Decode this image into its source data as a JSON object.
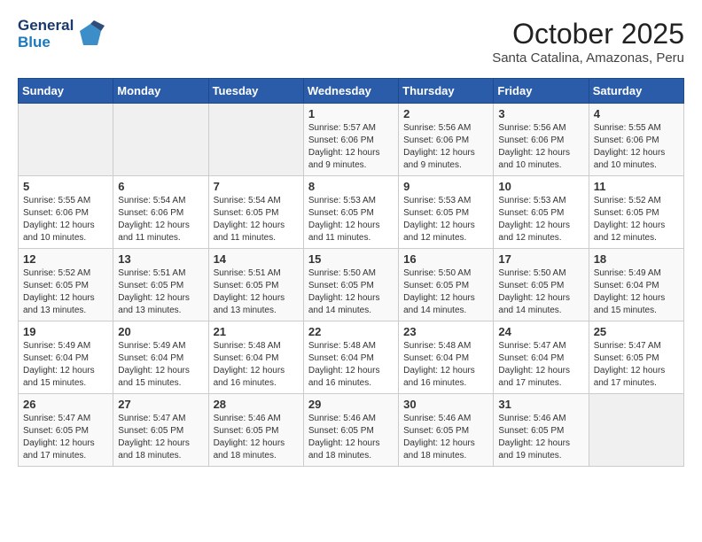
{
  "logo": {
    "line1": "General",
    "line2": "Blue"
  },
  "title": "October 2025",
  "subtitle": "Santa Catalina, Amazonas, Peru",
  "weekdays": [
    "Sunday",
    "Monday",
    "Tuesday",
    "Wednesday",
    "Thursday",
    "Friday",
    "Saturday"
  ],
  "weeks": [
    [
      {
        "day": "",
        "info": ""
      },
      {
        "day": "",
        "info": ""
      },
      {
        "day": "",
        "info": ""
      },
      {
        "day": "1",
        "info": "Sunrise: 5:57 AM\nSunset: 6:06 PM\nDaylight: 12 hours\nand 9 minutes."
      },
      {
        "day": "2",
        "info": "Sunrise: 5:56 AM\nSunset: 6:06 PM\nDaylight: 12 hours\nand 9 minutes."
      },
      {
        "day": "3",
        "info": "Sunrise: 5:56 AM\nSunset: 6:06 PM\nDaylight: 12 hours\nand 10 minutes."
      },
      {
        "day": "4",
        "info": "Sunrise: 5:55 AM\nSunset: 6:06 PM\nDaylight: 12 hours\nand 10 minutes."
      }
    ],
    [
      {
        "day": "5",
        "info": "Sunrise: 5:55 AM\nSunset: 6:06 PM\nDaylight: 12 hours\nand 10 minutes."
      },
      {
        "day": "6",
        "info": "Sunrise: 5:54 AM\nSunset: 6:06 PM\nDaylight: 12 hours\nand 11 minutes."
      },
      {
        "day": "7",
        "info": "Sunrise: 5:54 AM\nSunset: 6:05 PM\nDaylight: 12 hours\nand 11 minutes."
      },
      {
        "day": "8",
        "info": "Sunrise: 5:53 AM\nSunset: 6:05 PM\nDaylight: 12 hours\nand 11 minutes."
      },
      {
        "day": "9",
        "info": "Sunrise: 5:53 AM\nSunset: 6:05 PM\nDaylight: 12 hours\nand 12 minutes."
      },
      {
        "day": "10",
        "info": "Sunrise: 5:53 AM\nSunset: 6:05 PM\nDaylight: 12 hours\nand 12 minutes."
      },
      {
        "day": "11",
        "info": "Sunrise: 5:52 AM\nSunset: 6:05 PM\nDaylight: 12 hours\nand 12 minutes."
      }
    ],
    [
      {
        "day": "12",
        "info": "Sunrise: 5:52 AM\nSunset: 6:05 PM\nDaylight: 12 hours\nand 13 minutes."
      },
      {
        "day": "13",
        "info": "Sunrise: 5:51 AM\nSunset: 6:05 PM\nDaylight: 12 hours\nand 13 minutes."
      },
      {
        "day": "14",
        "info": "Sunrise: 5:51 AM\nSunset: 6:05 PM\nDaylight: 12 hours\nand 13 minutes."
      },
      {
        "day": "15",
        "info": "Sunrise: 5:50 AM\nSunset: 6:05 PM\nDaylight: 12 hours\nand 14 minutes."
      },
      {
        "day": "16",
        "info": "Sunrise: 5:50 AM\nSunset: 6:05 PM\nDaylight: 12 hours\nand 14 minutes."
      },
      {
        "day": "17",
        "info": "Sunrise: 5:50 AM\nSunset: 6:05 PM\nDaylight: 12 hours\nand 14 minutes."
      },
      {
        "day": "18",
        "info": "Sunrise: 5:49 AM\nSunset: 6:04 PM\nDaylight: 12 hours\nand 15 minutes."
      }
    ],
    [
      {
        "day": "19",
        "info": "Sunrise: 5:49 AM\nSunset: 6:04 PM\nDaylight: 12 hours\nand 15 minutes."
      },
      {
        "day": "20",
        "info": "Sunrise: 5:49 AM\nSunset: 6:04 PM\nDaylight: 12 hours\nand 15 minutes."
      },
      {
        "day": "21",
        "info": "Sunrise: 5:48 AM\nSunset: 6:04 PM\nDaylight: 12 hours\nand 16 minutes."
      },
      {
        "day": "22",
        "info": "Sunrise: 5:48 AM\nSunset: 6:04 PM\nDaylight: 12 hours\nand 16 minutes."
      },
      {
        "day": "23",
        "info": "Sunrise: 5:48 AM\nSunset: 6:04 PM\nDaylight: 12 hours\nand 16 minutes."
      },
      {
        "day": "24",
        "info": "Sunrise: 5:47 AM\nSunset: 6:04 PM\nDaylight: 12 hours\nand 17 minutes."
      },
      {
        "day": "25",
        "info": "Sunrise: 5:47 AM\nSunset: 6:05 PM\nDaylight: 12 hours\nand 17 minutes."
      }
    ],
    [
      {
        "day": "26",
        "info": "Sunrise: 5:47 AM\nSunset: 6:05 PM\nDaylight: 12 hours\nand 17 minutes."
      },
      {
        "day": "27",
        "info": "Sunrise: 5:47 AM\nSunset: 6:05 PM\nDaylight: 12 hours\nand 18 minutes."
      },
      {
        "day": "28",
        "info": "Sunrise: 5:46 AM\nSunset: 6:05 PM\nDaylight: 12 hours\nand 18 minutes."
      },
      {
        "day": "29",
        "info": "Sunrise: 5:46 AM\nSunset: 6:05 PM\nDaylight: 12 hours\nand 18 minutes."
      },
      {
        "day": "30",
        "info": "Sunrise: 5:46 AM\nSunset: 6:05 PM\nDaylight: 12 hours\nand 18 minutes."
      },
      {
        "day": "31",
        "info": "Sunrise: 5:46 AM\nSunset: 6:05 PM\nDaylight: 12 hours\nand 19 minutes."
      },
      {
        "day": "",
        "info": ""
      }
    ]
  ]
}
